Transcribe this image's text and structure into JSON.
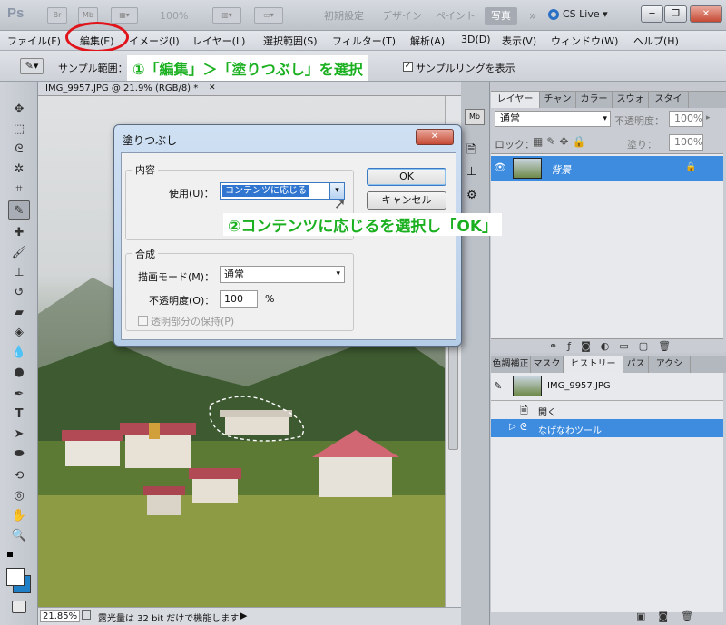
{
  "appbar": {
    "logo": "Ps",
    "zoom": "100%",
    "workspaces": [
      "初期設定",
      "デザイン",
      "ペイント",
      "写真"
    ],
    "more": "»",
    "cs_live": "CS Live ▾",
    "win_min": "─",
    "win_max": "❐",
    "win_close": "✕"
  },
  "menubar": {
    "items": [
      "ファイル(F)",
      "編集(E)",
      "イメージ(I)",
      "レイヤー(L)",
      "選択範囲(S)",
      "フィルター(T)",
      "解析(A)",
      "3D(D)",
      "表示(V)",
      "ウィンドウ(W)",
      "ヘルプ(H)"
    ]
  },
  "options": {
    "sample_label": "サンプル範囲：",
    "show_ring_label": "サンプルリングを表示",
    "show_ring_checked": true
  },
  "annotation": {
    "step1": "①「編集」＞「塗りつぶし」を選択",
    "step2": "②コンテンツに応じるを選択し「OK」",
    "color": "#1bb020"
  },
  "document": {
    "tab_title": "IMG_9957.JPG @ 21.9% (RGB/8) *",
    "tab_close": "✕",
    "zoom": "21.85%",
    "status": "露光量は 32 bit だけで機能します"
  },
  "layers_panel": {
    "tabs": [
      "レイヤー",
      "チャン",
      "カラー",
      "スウォ",
      "スタイ"
    ],
    "blend_mode": "通常",
    "opacity_label": "不透明度：",
    "opacity_value": "100%",
    "lock_label": "ロック：",
    "fill_label": "塗り：",
    "fill_value": "100%",
    "layers": [
      {
        "name": "背景",
        "locked": true,
        "visible": true
      }
    ]
  },
  "history_panel": {
    "tabs": [
      "色調補正",
      "マスク",
      "ヒストリー",
      "パス",
      "アクシ"
    ],
    "snapshot": "IMG_9957.JPG",
    "items": [
      "開く",
      "なげなわツール"
    ],
    "selected_index": 1
  },
  "dialog": {
    "title": "塗りつぶし",
    "close": "✕",
    "contents_group": "内容",
    "use_label": "使用(U)：",
    "use_value": "コンテンツに応じる",
    "blend_group": "合成",
    "mode_label": "描画モード(M)：",
    "mode_value": "通常",
    "opacity_label": "不透明度(O)：",
    "opacity_value": "100",
    "opacity_unit": "%",
    "preserve_label": "透明部分の保持(P)",
    "preserve_checked": false,
    "ok_label": "OK",
    "cancel_label": "キャンセル"
  }
}
